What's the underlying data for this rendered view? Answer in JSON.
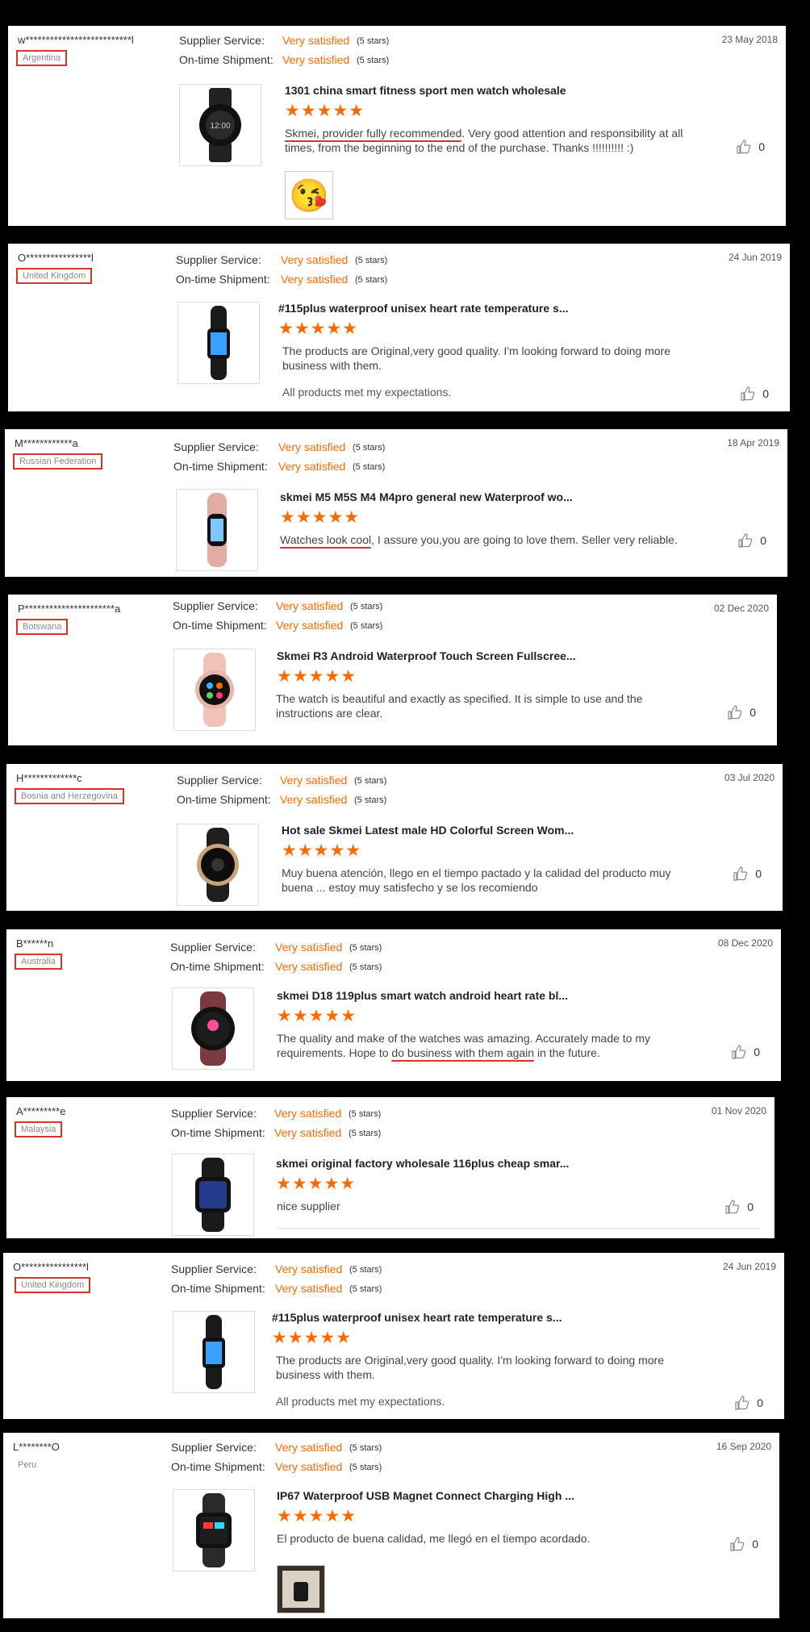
{
  "labels": {
    "supplier_service": "Supplier Service:",
    "ontime_shipment": "On-time Shipment:"
  },
  "reviews": [
    {
      "name": "w**************************l",
      "country": "Argentina",
      "date": "23 May 2018",
      "supplier": "Very satisfied",
      "supplier_stars": "(5 stars)",
      "shipment": "Very satisfied",
      "shipment_stars": "(5 stars)",
      "title": "1301 china smart fitness sport men watch wholesale",
      "stars": "★★★★★",
      "comment_hl": "Skmei, provider fully recommended",
      "comment_rest": ". Very good attention and responsibility at all times, from the beginning to the end of the purchase. Thanks !!!!!!!!!! :)",
      "likes": "0",
      "emoji": "😘"
    },
    {
      "name": "O****************l",
      "country": "United Kingdom",
      "date": "24 Jun 2019",
      "supplier": "Very satisfied",
      "supplier_stars": "(5 stars)",
      "shipment": "Very satisfied",
      "shipment_stars": "(5 stars)",
      "title": "#115plus waterproof unisex heart rate temperature s...",
      "stars": "★★★★★",
      "comment_pre": "The products are Original,very good quality. I'm looking forward to ",
      "comment_hl": "doing more business with them.",
      "extra": "All products met my expectations.",
      "likes": "0"
    },
    {
      "name": "M************a",
      "country": "Russian Federation",
      "date": "18 Apr 2019",
      "supplier": "Very satisfied",
      "supplier_stars": "(5 stars)",
      "shipment": "Very satisfied",
      "shipment_stars": "(5 stars)",
      "title": "skmei M5 M5S M4 M4pro general new Waterproof wo...",
      "stars": "★★★★★",
      "comment_hl": "Watches look cool",
      "comment_rest": ", I assure you,you are going to love them. Seller very reliable.",
      "likes": "0"
    },
    {
      "name": "P**********************a",
      "country": "Botswana",
      "date": "02 Dec 2020",
      "supplier": "Very satisfied",
      "supplier_stars": "(5 stars)",
      "shipment": "Very satisfied",
      "shipment_stars": "(5 stars)",
      "title": "Skmei R3 Android Waterproof Touch Screen Fullscree...",
      "stars": "★★★★★",
      "comment_pre": "The watch is beautiful and exactly as specified. ",
      "comment_hl": "It is simple to use and the instructions are clear.",
      "likes": "0"
    },
    {
      "name": "H*************c",
      "country": "Bosnia and Herzegovina",
      "date": "03 Jul 2020",
      "supplier": "Very satisfied",
      "supplier_stars": "(5 stars)",
      "shipment": "Very satisfied",
      "shipment_stars": "(5 stars)",
      "title": "Hot sale Skmei Latest male HD Colorful Screen Wom...",
      "stars": "★★★★★",
      "comment_pre": "Muy buena atención, llego en el tiempo pactado y la calidad del producto muy buena ... estoy muy satisfecho y se los recomiendo",
      "likes": "0"
    },
    {
      "name": "B******n",
      "country": "Australia",
      "date": "08 Dec 2020",
      "supplier": "Very satisfied",
      "supplier_stars": "(5 stars)",
      "shipment": "Very satisfied",
      "shipment_stars": "(5 stars)",
      "title": "skmei D18 119plus smart watch android heart rate bl...",
      "stars": "★★★★★",
      "comment_pre": "The quality and make of the watches was amazing. Accurately made to my requirements. Hope to ",
      "comment_hl": "do business with them again",
      "comment_rest": " in the future.",
      "likes": "0"
    },
    {
      "name": "A*********e",
      "country": "Malaysia",
      "date": "01 Nov 2020",
      "supplier": "Very satisfied",
      "supplier_stars": "(5 stars)",
      "shipment": "Very satisfied",
      "shipment_stars": "(5 stars)",
      "title": "skmei original factory wholesale 116plus cheap smar...",
      "stars": "★★★★★",
      "comment_pre": "nice supplier",
      "likes": "0"
    },
    {
      "name": "O****************l",
      "country": "United Kingdom",
      "date": "24 Jun 2019",
      "supplier": "Very satisfied",
      "supplier_stars": "(5 stars)",
      "shipment": "Very satisfied",
      "shipment_stars": "(5 stars)",
      "title": "#115plus waterproof unisex heart rate temperature s...",
      "stars": "★★★★★",
      "comment_pre": "The products are Original,very good quality. I'm looking forward to ",
      "comment_hl": "doing more business with them.",
      "extra": "All products met my expectations.",
      "likes": "0"
    },
    {
      "name": "L********O",
      "country": "Peru",
      "date": "16 Sep 2020",
      "supplier": "Very satisfied",
      "supplier_stars": "(5 stars)",
      "shipment": "Very satisfied",
      "shipment_stars": "(5 stars)",
      "title": "IP67 Waterproof USB Magnet Connect Charging High ...",
      "stars": "★★★★★",
      "comment_pre": "El producto de buena calidad, me llegó en el tiempo acordado.",
      "likes": "0"
    }
  ]
}
